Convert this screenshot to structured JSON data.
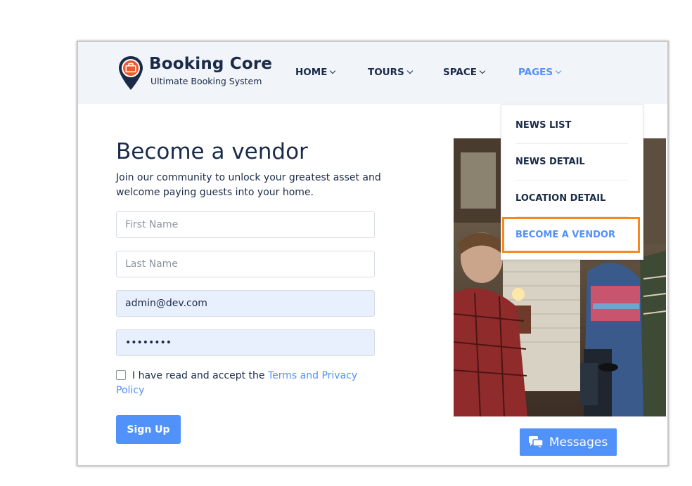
{
  "brand": {
    "name": "Booking Core",
    "tagline": "Ultimate Booking System",
    "pin_color": "#1a2b48",
    "suitcase_color": "#f05a2a"
  },
  "nav": {
    "items": [
      {
        "label": "HOME",
        "active": false
      },
      {
        "label": "TOURS",
        "active": false
      },
      {
        "label": "SPACE",
        "active": false
      },
      {
        "label": "PAGES",
        "active": true
      }
    ]
  },
  "dropdown": {
    "items": [
      {
        "label": "NEWS LIST"
      },
      {
        "label": "NEWS DETAIL"
      },
      {
        "label": "LOCATION DETAIL"
      },
      {
        "label": "BECOME A VENDOR",
        "highlighted": true
      }
    ],
    "highlight_color": "#f5891f"
  },
  "form": {
    "title": "Become a vendor",
    "subtitle": "Join our community to unlock your greatest asset and welcome paying guests into your home.",
    "first_name": {
      "placeholder": "First Name",
      "value": ""
    },
    "last_name": {
      "placeholder": "Last Name",
      "value": ""
    },
    "email": {
      "placeholder": "",
      "value": "admin@dev.com"
    },
    "password": {
      "placeholder": "",
      "value": "••••••••"
    },
    "terms_prefix": "I have read and accept the ",
    "terms_link": "Terms and Privacy Policy",
    "terms_checked": false,
    "submit_label": "Sign Up"
  },
  "chat": {
    "label": "Messages"
  },
  "colors": {
    "primary": "#5191fa",
    "heading": "#1a2b48",
    "header_bg": "#f1f4f8",
    "autofill_bg": "#e8f0fe"
  }
}
